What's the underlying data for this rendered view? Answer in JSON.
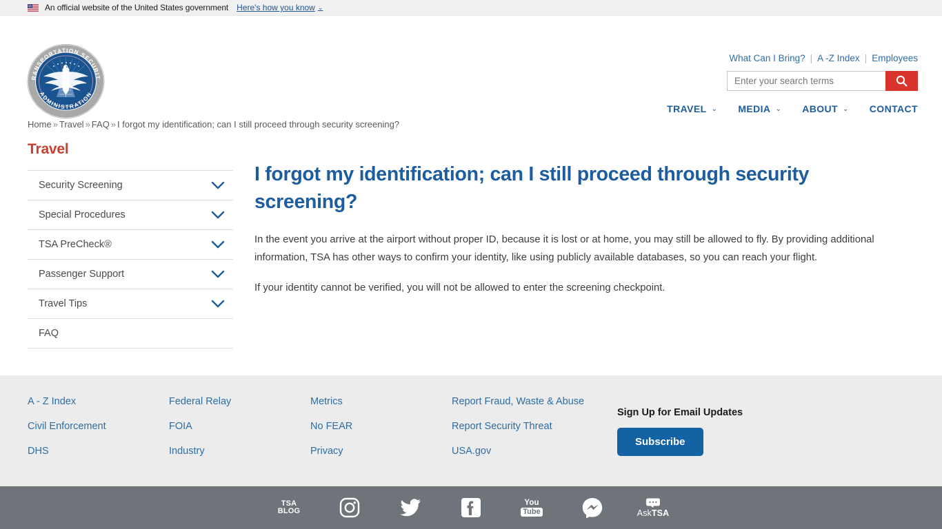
{
  "gov_banner": {
    "flag_icon": "us-flag-icon",
    "text": "An official website of the United States government",
    "how_you_know_label": "Here's how you know",
    "chevron": "⌄"
  },
  "header": {
    "logo_alt": "Transportation Security Administration seal",
    "logo_text_top": "TRANSPORTATION SECURITY",
    "logo_text_bottom": "ADMINISTRATION",
    "utility_links": [
      {
        "label": "What Can I Bring?"
      },
      {
        "label": "A -Z Index"
      },
      {
        "label": "Employees"
      }
    ],
    "utility_separator": "|",
    "search": {
      "placeholder": "Enter your search terms",
      "value": "",
      "button_icon": "search-icon"
    },
    "nav": [
      {
        "label": "TRAVEL",
        "has_dropdown": true
      },
      {
        "label": "MEDIA",
        "has_dropdown": true
      },
      {
        "label": "ABOUT",
        "has_dropdown": true
      },
      {
        "label": "CONTACT",
        "has_dropdown": false
      }
    ],
    "nav_chevron": "⌄"
  },
  "breadcrumb": {
    "separator": "»",
    "items": [
      {
        "label": "Home",
        "link": true
      },
      {
        "label": "Travel",
        "link": true
      },
      {
        "label": "FAQ",
        "link": true
      },
      {
        "label": "I forgot my identification; can I still proceed through security screening?",
        "link": false
      }
    ]
  },
  "sidebar": {
    "title": "Travel",
    "items": [
      {
        "label": "Security Screening",
        "expandable": true
      },
      {
        "label": "Special Procedures",
        "expandable": true
      },
      {
        "label": "TSA PreCheck®",
        "expandable": true
      },
      {
        "label": "Passenger Support",
        "expandable": true
      },
      {
        "label": "Travel Tips",
        "expandable": true
      },
      {
        "label": "FAQ",
        "expandable": false
      }
    ]
  },
  "main": {
    "title": "I forgot my identification; can I still proceed through security screening?",
    "paragraphs": [
      "In the event you arrive at the airport without proper ID, because it is lost or at home, you may still be allowed to fly. By providing additional information, TSA has other ways to confirm your identity, like using publicly available databases, so you can reach your flight.",
      "If your identity cannot be verified, you will not be allowed to enter the screening checkpoint."
    ]
  },
  "footer": {
    "columns": [
      {
        "links": [
          {
            "label": "A - Z Index"
          },
          {
            "label": "Civil Enforcement"
          },
          {
            "label": "DHS"
          }
        ]
      },
      {
        "links": [
          {
            "label": "Federal Relay"
          },
          {
            "label": "FOIA"
          },
          {
            "label": "Industry"
          }
        ]
      },
      {
        "links": [
          {
            "label": "Metrics"
          },
          {
            "label": "No FEAR"
          },
          {
            "label": "Privacy"
          }
        ]
      },
      {
        "links": [
          {
            "label": "Report Fraud, Waste & Abuse"
          },
          {
            "label": "Report Security Threat"
          },
          {
            "label": "USA.gov"
          }
        ]
      }
    ],
    "signup": {
      "title": "Sign Up for Email Updates",
      "button_label": "Subscribe"
    }
  },
  "social": {
    "items": [
      {
        "name": "tsa-blog-icon",
        "label_line1": "TSA",
        "label_line2": "BLOG"
      },
      {
        "name": "instagram-icon",
        "label": "Instagram"
      },
      {
        "name": "twitter-icon",
        "label": "Twitter"
      },
      {
        "name": "facebook-icon",
        "label": "Facebook"
      },
      {
        "name": "youtube-icon",
        "label_line1": "You",
        "label_line2": "Tube"
      },
      {
        "name": "messenger-icon",
        "label": "Messenger"
      },
      {
        "name": "asktsa-icon",
        "label_ask": "Ask",
        "label_tsa": "TSA"
      }
    ]
  },
  "colors": {
    "brand_blue": "#1d5c9e",
    "link_blue": "#2e6da4",
    "accent_red": "#d9342b",
    "sidebar_title_red": "#c8402f",
    "footer_bg": "#ececec",
    "social_bar_bg": "#6e747a",
    "banner_bg": "#f0f0f0",
    "subscribe_blue": "#1362a3"
  }
}
